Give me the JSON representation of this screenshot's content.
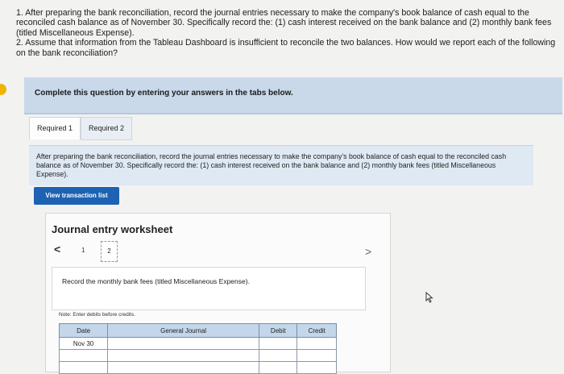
{
  "question": {
    "line1": "1. After preparing the bank reconciliation, record the journal entries necessary to make the company's book balance of cash equal to the reconciled cash balance as of November 30. Specifically record the: (1) cash interest received on the bank balance and (2) monthly bank fees (titled Miscellaneous Expense).",
    "line2": "2. Assume that information from the Tableau Dashboard is insufficient to reconcile the two balances. How would we report each of the following on the bank reconciliation?"
  },
  "instructions": "Complete this question by entering your answers in the tabs below.",
  "tabs": [
    {
      "label": "Required 1"
    },
    {
      "label": "Required 2"
    }
  ],
  "description": "After preparing the bank reconciliation, record the journal entries necessary to make the company's book balance of cash equal to the reconciled cash balance as of November 30. Specifically record the: (1) cash interest received on the bank balance and (2) monthly bank fees (titled Miscellaneous Expense).",
  "view_button": "View transaction list",
  "worksheet": {
    "title": "Journal entry worksheet",
    "prev": "<",
    "next": ">",
    "pages": [
      "1",
      "2"
    ],
    "prompt": "Record the monthly bank fees (titled Miscellaneous Expense).",
    "note": "Note: Enter debits before credits.",
    "columns": [
      "Date",
      "General Journal",
      "Debit",
      "Credit"
    ],
    "rows": [
      {
        "date": "Nov 30"
      },
      {
        "date": ""
      },
      {
        "date": ""
      }
    ]
  },
  "colors": {
    "accent": "#1d62b3",
    "instruction_bg": "#c9d9ea",
    "header_bg": "#c3d6ea"
  },
  "icons": [
    "chevron-left-icon",
    "chevron-right-icon",
    "mouse-cursor-icon"
  ]
}
